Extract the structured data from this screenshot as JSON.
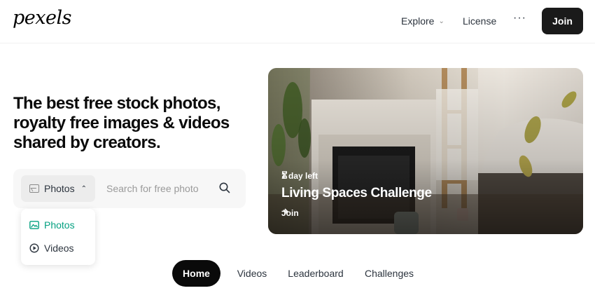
{
  "header": {
    "logo": "pexels",
    "nav": {
      "explore": "Explore",
      "license": "License",
      "more": "···",
      "join": "Join"
    }
  },
  "hero_text": {
    "headline": "The best free stock photos, royalty free images & videos shared by creators."
  },
  "search": {
    "type_selected": "Photos",
    "placeholder": "Search for free photo",
    "options": [
      "Photos",
      "Videos"
    ]
  },
  "challenge_card": {
    "timer": "1 day left",
    "title": "Living Spaces Challenge",
    "link": "Join"
  },
  "tabs": [
    "Home",
    "Videos",
    "Leaderboard",
    "Challenges"
  ],
  "colors": {
    "accent_green": "#05a081",
    "dark": "#0a0a0a"
  }
}
